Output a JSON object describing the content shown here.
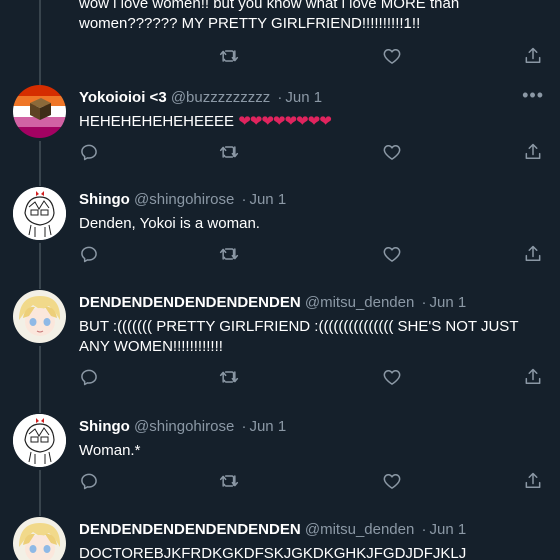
{
  "tweets": [
    {
      "name": "",
      "handle": "",
      "date": "",
      "text": "wow i love women!! but you know what i love MORE than women?????? MY PRETTY GIRLFRIEND!!!!!!!!!!1!!",
      "avatar": "anime-girl"
    },
    {
      "name": "Yokoioioi <3",
      "handle": "@buzzzzzzzzz",
      "date": "Jun 1",
      "text": "HEHEHEHEHEHEEEE ",
      "hearts": "❤❤❤❤❤❤❤❤",
      "avatar": "lesbian-flag-cube"
    },
    {
      "name": "Shingo",
      "handle": "@shingohirose",
      "date": "Jun 1",
      "text": "Denden, Yokoi is a woman.",
      "avatar": "chibi-sketch"
    },
    {
      "name": "DENDENDENDENDENDENDEN",
      "handle": "@mitsu_denden",
      "date": "Jun 1",
      "text": "BUT :((((((( PRETTY GIRLFRIEND :((((((((((((((( SHE'S NOT JUST ANY WOMEN!!!!!!!!!!!!",
      "avatar": "blonde-anime"
    },
    {
      "name": "Shingo",
      "handle": "@shingohirose",
      "date": "Jun 1",
      "text": "Woman.*",
      "avatar": "chibi-sketch"
    },
    {
      "name": "DENDENDENDENDENDENDEN",
      "handle": "@mitsu_denden",
      "date": "Jun 1",
      "text": "DOCTOREBJKFRDKGKDFSKJGKDKGHKJFGDJDFJKLJ",
      "avatar": "blonde-anime"
    }
  ],
  "colors": {
    "background": "#15202b",
    "secondary_text": "#8b98a5",
    "heart": "#e0245e",
    "thread_line": "#38444d"
  },
  "icons": {
    "reply": "reply-icon",
    "retweet": "retweet-icon",
    "like": "like-icon",
    "share": "share-icon",
    "more": "more-icon"
  },
  "more_glyph": "•••"
}
